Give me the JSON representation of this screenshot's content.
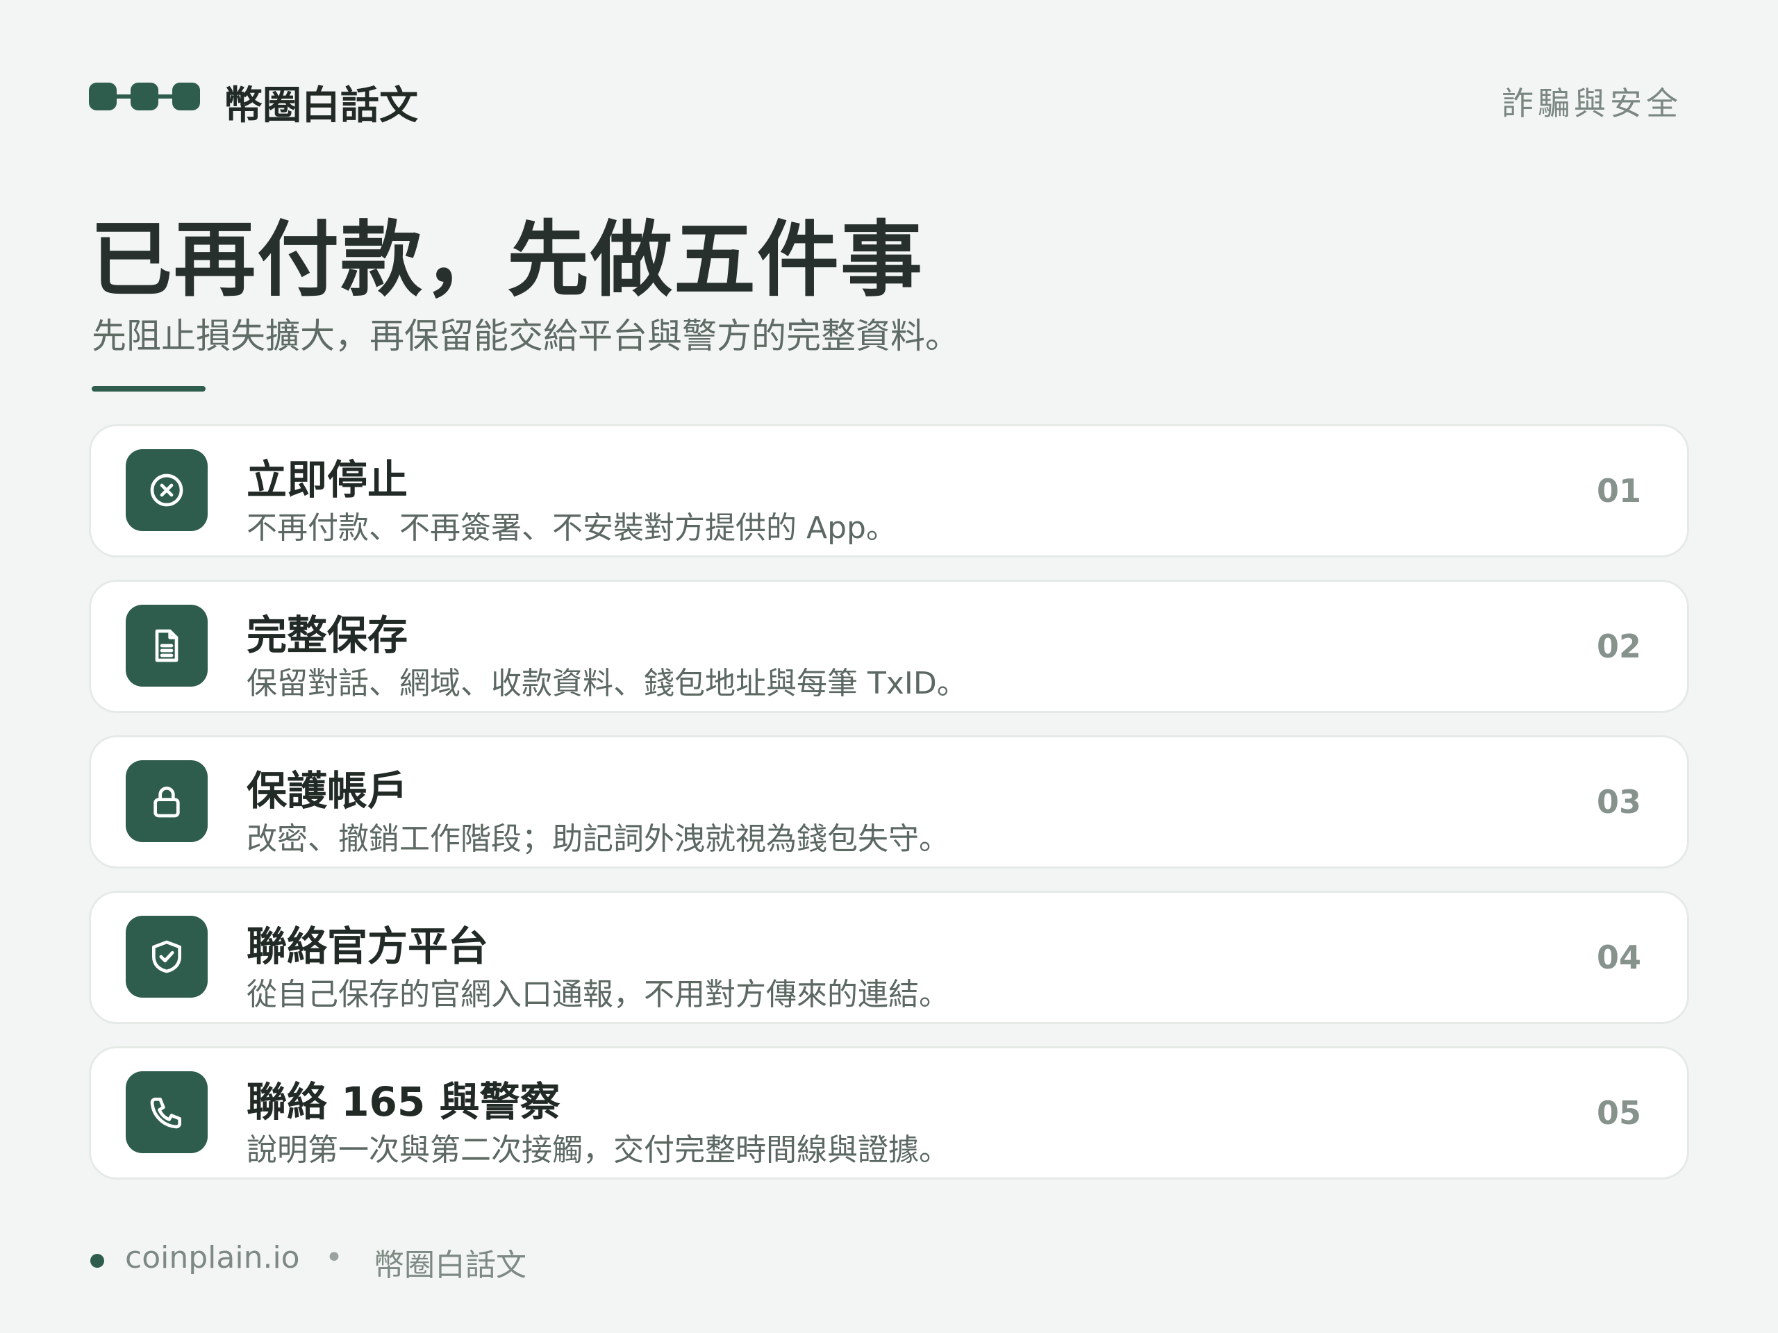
{
  "header": {
    "brand": "幣圈白話文",
    "category": "詐騙與安全"
  },
  "title": "已再付款，先做五件事",
  "subtitle": "先阻止損失擴大，再保留能交給平台與警方的完整資料。",
  "steps": [
    {
      "icon": "stop-circle-x-icon",
      "title": "立即停止",
      "desc": "不再付款、不再簽署、不安裝對方提供的 App。",
      "num": "01"
    },
    {
      "icon": "document-icon",
      "title": "完整保存",
      "desc": "保留對話、網域、收款資料、錢包地址與每筆 TxID。",
      "num": "02"
    },
    {
      "icon": "lock-icon",
      "title": "保護帳戶",
      "desc": "改密、撤銷工作階段；助記詞外洩就視為錢包失守。",
      "num": "03"
    },
    {
      "icon": "shield-check-icon",
      "title": "聯絡官方平台",
      "desc": "從自己保存的官網入口通報，不用對方傳來的連結。",
      "num": "04"
    },
    {
      "icon": "phone-icon",
      "title": "聯絡 165 與警察",
      "desc": "說明第一次與第二次接觸，交付完整時間線與證據。",
      "num": "05"
    }
  ],
  "footer": {
    "site": "coinplain.io",
    "separator": "•",
    "brand": "幣圈白話文"
  },
  "colors": {
    "accent": "#2f5d4d",
    "background": "#f3f5f4",
    "card": "#ffffff"
  }
}
